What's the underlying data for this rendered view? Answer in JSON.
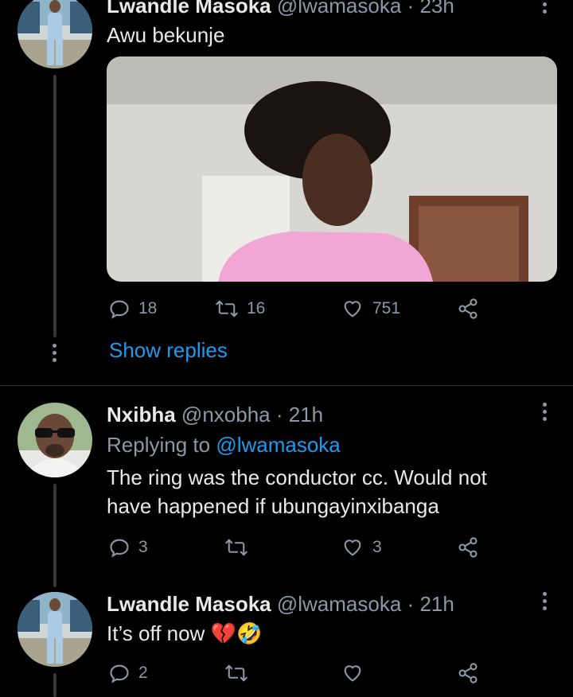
{
  "tweets": [
    {
      "name": "Lwandle Masoka",
      "handle": "@lwamasoka",
      "time": "23h",
      "text": "Awu bekunje",
      "replies": "18",
      "retweets": "16",
      "likes": "751"
    },
    {
      "name": "Nxibha",
      "handle": "@nxobha",
      "time": "21h",
      "replying_prefix": "Replying to",
      "replying_to": "@lwamasoka",
      "text_line1": "The ring was the conductor cc. Would not",
      "text_line2": "have happened if ubungayinxibanga",
      "replies": "3",
      "retweets": "",
      "likes": "3"
    },
    {
      "name": "Lwandle Masoka",
      "handle": "@lwamasoka",
      "time": "21h",
      "text": "It’s off now",
      "emoji": "💔🤣",
      "replies": "2",
      "retweets": "",
      "likes": ""
    }
  ],
  "show_replies": "Show replies",
  "separator": "·",
  "colors": {
    "background": "#000000",
    "text": "#e7e9ea",
    "secondary": "#8b98a5",
    "link": "#1d9bf0"
  },
  "icons": [
    "reply-icon",
    "retweet-icon",
    "like-icon",
    "share-icon",
    "more-icon"
  ]
}
